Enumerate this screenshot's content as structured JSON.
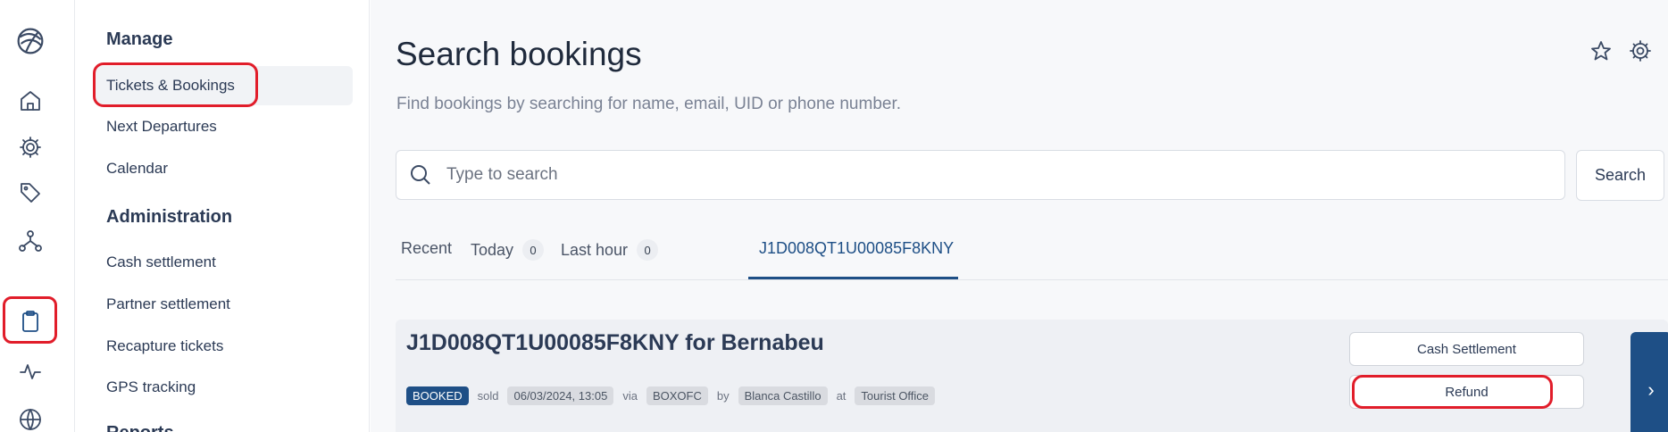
{
  "rail": {
    "logo": "globe-logo-icon",
    "icons": [
      "home-icon",
      "gear-icon",
      "tag-icon",
      "network-icon",
      "clipboard-icon",
      "activity-icon",
      "globe-icon"
    ]
  },
  "menu": {
    "sections": [
      {
        "heading": "Manage",
        "items": [
          "Tickets & Bookings",
          "Next Departures",
          "Calendar"
        ]
      },
      {
        "heading": "Administration",
        "items": [
          "Cash settlement",
          "Partner settlement",
          "Recapture tickets",
          "GPS tracking"
        ]
      },
      {
        "heading": "Reports"
      }
    ]
  },
  "page": {
    "title": "Search bookings",
    "subtitle": "Find bookings by searching for name, email, UID or phone number."
  },
  "search": {
    "placeholder": "Type to search",
    "button_label": "Search"
  },
  "tabs": [
    {
      "label": "Recent"
    },
    {
      "label": "Today",
      "count": "0"
    },
    {
      "label": "Last hour",
      "count": "0"
    },
    {
      "label": "J1D008QT1U00085F8KNY",
      "active": true
    }
  ],
  "booking": {
    "title": "J1D008QT1U00085F8KNY for Bernabeu",
    "status": "BOOKED",
    "sold_label": "sold",
    "sold_date": "06/03/2024, 13:05",
    "via_label": "via",
    "via_value": "BOXOFC",
    "by_label": "by",
    "by_value": "Blanca Castillo",
    "at_label": "at",
    "at_value": "Tourist Office",
    "cash_settlement_label": "Cash Settlement",
    "refund_label": "Refund",
    "next_glyph": "›"
  },
  "colors": {
    "accent": "#1e4f86",
    "highlight": "#e11d2a"
  }
}
